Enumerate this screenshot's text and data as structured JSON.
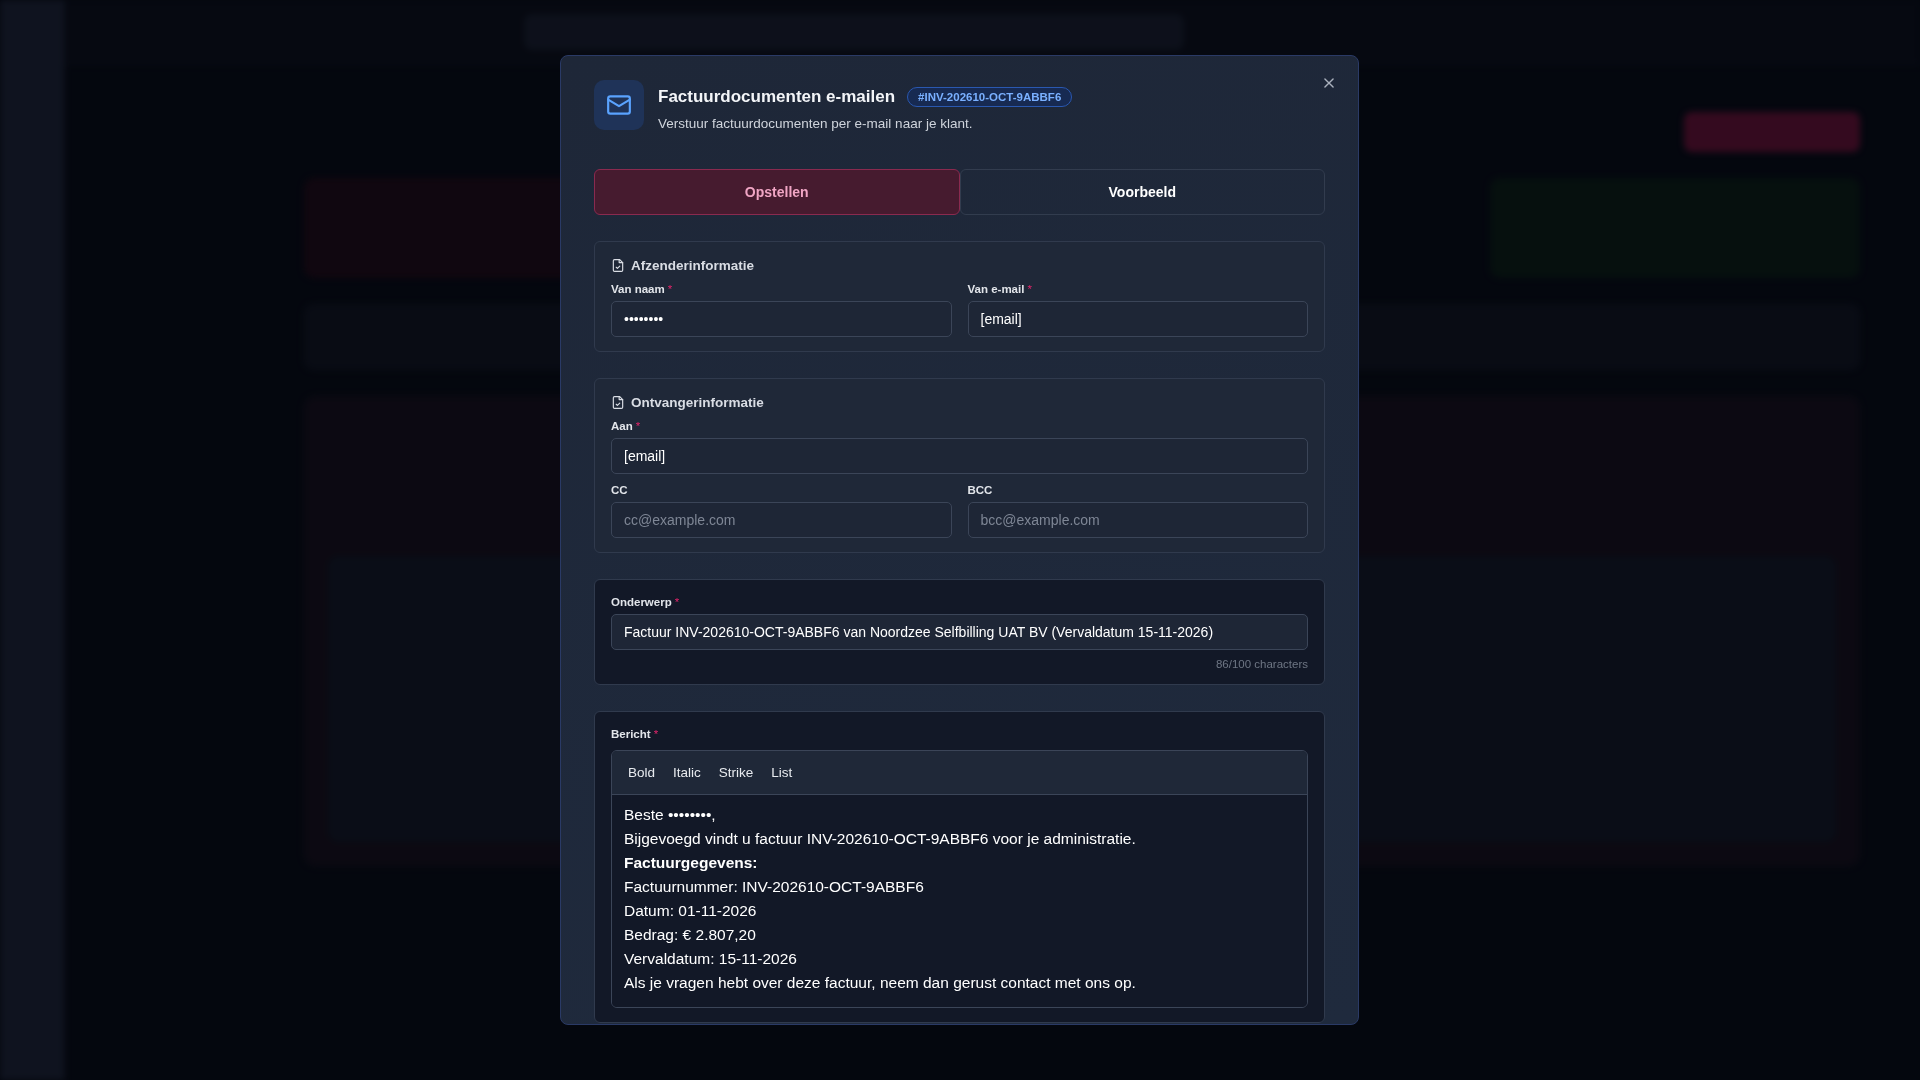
{
  "dialog": {
    "title": "Factuurdocumenten e-mailen",
    "badge": "#INV-202610-OCT-9ABBF6",
    "subtitle": "Verstuur factuurdocumenten per e-mail naar je klant.",
    "tabs": [
      {
        "label": "Opstellen",
        "selected": true
      },
      {
        "label": "Voorbeeld",
        "selected": false
      }
    ],
    "sections": [
      {
        "heading": "Afzenderinformatie",
        "rows": [
          [
            {
              "label": "Van naam",
              "required_mark": "*",
              "value": "••••••••"
            },
            {
              "label": "Van e-mail",
              "required_mark": "*",
              "value": "[email]"
            }
          ]
        ]
      },
      {
        "heading": "Ontvangerinformatie",
        "rows": [
          [
            {
              "label": "Aan",
              "required_mark": "*",
              "value": "[email]"
            }
          ],
          [
            {
              "label": "CC",
              "placeholder": "cc@example.com"
            },
            {
              "label": "BCC",
              "placeholder": "bcc@example.com"
            }
          ]
        ]
      }
    ],
    "subject": {
      "label": "Onderwerp",
      "required_mark": "*",
      "value": "Factuur INV-202610-OCT-9ABBF6 van Noordzee Selfbilling UAT BV (Vervaldatum 15-11-2026)",
      "counter": "86/100 characters"
    },
    "message": {
      "label": "Bericht",
      "required_mark": "*",
      "toolbar": [
        "Bold",
        "Italic",
        "Strike",
        "List"
      ],
      "lines": [
        {
          "text": "Beste ••••••••,",
          "bold": false
        },
        {
          "text": "Bijgevoegd vindt u factuur INV-202610-OCT-9ABBF6 voor je administratie.",
          "bold": false
        },
        {
          "text": "Factuurgegevens:",
          "bold": true
        },
        {
          "text": "Factuurnummer: INV-202610-OCT-9ABBF6",
          "bold": false
        },
        {
          "text": "Datum: 01-11-2026",
          "bold": false
        },
        {
          "text": "Bedrag: € 2.807,20",
          "bold": false
        },
        {
          "text": "Vervaldatum: 15-11-2026",
          "bold": false
        },
        {
          "text": "Als je vragen hebt over deze factuur, neem dan gerust contact met ons op.",
          "bold": false
        }
      ]
    }
  }
}
